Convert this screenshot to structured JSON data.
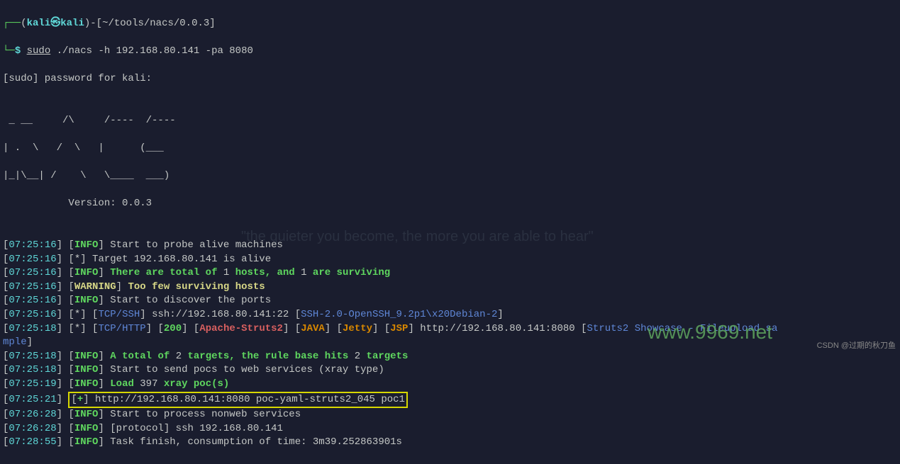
{
  "prompt": {
    "user": "kali",
    "host": "kali",
    "skull": "㉿",
    "cwd": "~/tools/nacs/0.0.3",
    "symbol": "$",
    "cmd_sudo": "sudo",
    "cmd_rest": " ./nacs -h 192.168.80.141 -pa 8080"
  },
  "sudo_prompt": "[sudo] password for kali: ",
  "banner": {
    "l1": " _ __     /\\     /----  /----",
    "l2": "| .  \\   /  \\   |      (___",
    "l3": "|_|\\__| /    \\   \\____  ___)",
    "l4": "           Version: 0.0.3"
  },
  "lines": [
    {
      "ts": "07:25:16",
      "tag": "INFO",
      "tagColor": "green",
      "segs": [
        {
          "t": " Start to probe alive machines"
        }
      ]
    },
    {
      "ts": "07:25:16",
      "tag": "*",
      "tagColor": "white",
      "segs": [
        {
          "t": " Target 192.168.80.141 is alive"
        }
      ]
    },
    {
      "ts": "07:25:16",
      "tag": "INFO",
      "tagColor": "green",
      "segs": [
        {
          "t": " There are total of ",
          "c": "green-b"
        },
        {
          "t": "1"
        },
        {
          "t": " hosts, and ",
          "c": "green-b"
        },
        {
          "t": "1"
        },
        {
          "t": " are surviving",
          "c": "green-b"
        }
      ]
    },
    {
      "ts": "07:25:16",
      "tag": "WARNING",
      "tagColor": "yellow",
      "segs": [
        {
          "t": " Too few surviving hosts",
          "c": "yellow"
        }
      ]
    },
    {
      "ts": "07:25:16",
      "tag": "INFO",
      "tagColor": "green",
      "segs": [
        {
          "t": " Start to discover the ports"
        }
      ]
    },
    {
      "ts": "07:25:16",
      "tag": "*",
      "tagColor": "white",
      "segs": [
        {
          "t": " ["
        },
        {
          "t": "TCP/SSH",
          "c": "blue"
        },
        {
          "t": "] ssh://192.168.80.141:22 ["
        },
        {
          "t": "SSH-2.0-OpenSSH_9.2p1\\x20Debian-2",
          "c": "blue"
        },
        {
          "t": "]"
        }
      ]
    },
    {
      "ts": "07:25:18",
      "tag": "*",
      "tagColor": "white",
      "segs": [
        {
          "t": " ["
        },
        {
          "t": "TCP/HTTP",
          "c": "blue"
        },
        {
          "t": "] ["
        },
        {
          "t": "200",
          "c": "green-b"
        },
        {
          "t": "] ["
        },
        {
          "t": "Apache-Struts2",
          "c": "red"
        },
        {
          "t": "] ["
        },
        {
          "t": "JAVA",
          "c": "orange"
        },
        {
          "t": "] ["
        },
        {
          "t": "Jetty",
          "c": "orange"
        },
        {
          "t": "] ["
        },
        {
          "t": "JSP",
          "c": "orange"
        },
        {
          "t": "] http://192.168.80.141:8080 ["
        },
        {
          "t": "Struts2 Showcase - Fileupload sa",
          "c": "blue"
        }
      ]
    },
    {
      "wrap": true,
      "segs": [
        {
          "t": "mple",
          "c": "blue"
        },
        {
          "t": "]"
        }
      ]
    },
    {
      "ts": "07:25:18",
      "tag": "INFO",
      "tagColor": "green",
      "segs": [
        {
          "t": " A total of ",
          "c": "green-b"
        },
        {
          "t": "2"
        },
        {
          "t": " targets, the rule base hits ",
          "c": "green-b"
        },
        {
          "t": "2"
        },
        {
          "t": " targets",
          "c": "green-b"
        }
      ]
    },
    {
      "ts": "07:25:18",
      "tag": "INFO",
      "tagColor": "green",
      "segs": [
        {
          "t": " Start to send pocs to web services (xray type)"
        }
      ]
    },
    {
      "ts": "07:25:19",
      "tag": "INFO",
      "tagColor": "green",
      "segs": [
        {
          "t": " Load ",
          "c": "green-b"
        },
        {
          "t": "397"
        },
        {
          "t": " xray poc(s)",
          "c": "green-b"
        }
      ]
    },
    {
      "ts": "07:25:21",
      "hl": true,
      "segs": [
        {
          "t": "[",
          "c": "white"
        },
        {
          "t": "+",
          "c": "green-b"
        },
        {
          "t": "]",
          "c": "white"
        },
        {
          "t": " http://192.168.80.141:8080 poc-yaml-struts2_045 poc1"
        }
      ]
    },
    {
      "ts": "07:26:28",
      "tag": "INFO",
      "tagColor": "green",
      "segs": [
        {
          "t": " Start to process nonweb services"
        }
      ]
    },
    {
      "ts": "07:26:28",
      "tag": "INFO",
      "tagColor": "green",
      "segs": [
        {
          "t": " [protocol] ssh 192.168.80.141"
        }
      ]
    },
    {
      "ts": "07:28:55",
      "tag": "INFO",
      "tagColor": "green",
      "segs": [
        {
          "t": " Task finish, consumption of time: 3m39.252863901s"
        }
      ]
    }
  ],
  "watermark": "www.9969.net",
  "csdn": "CSDN @过期的秋刀鱼",
  "faded": "\"the quieter you become, the more you are able to hear\""
}
